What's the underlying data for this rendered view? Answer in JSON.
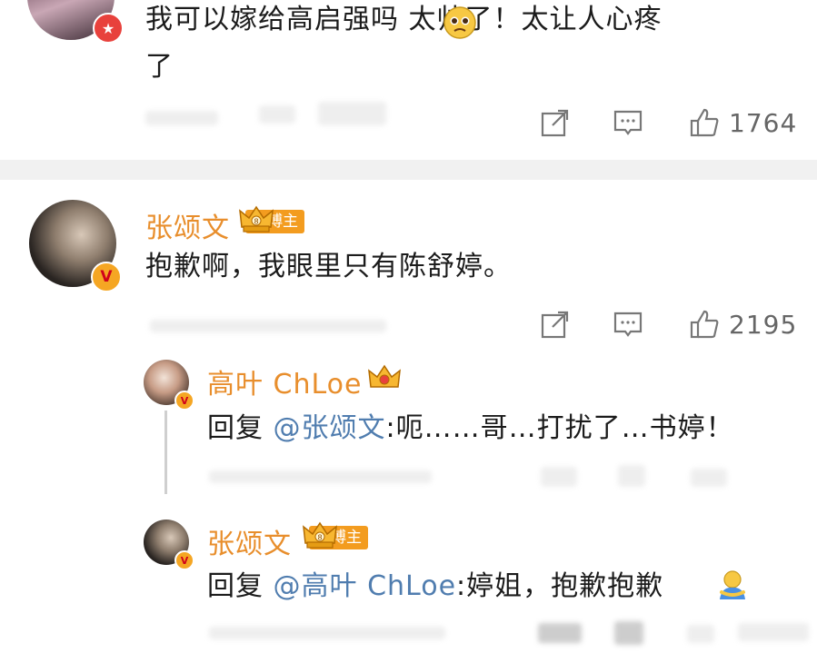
{
  "comments": [
    {
      "text": "我可以嫁给高启强吗 太帅了！太让人心疼",
      "text_line2": "了",
      "emoji": "pleading-face-icon",
      "like_count": "1764",
      "badge_color": "#e8413c"
    },
    {
      "author": "张颂文",
      "tag": "博主",
      "text": "抱歉啊，我眼里只有陈舒婷。",
      "like_count": "2195",
      "replies": [
        {
          "author": "高叶 ChLoe",
          "reply_prefix": "回复",
          "mention": "@张颂文",
          "text": ":呃……哥…打扰了…书婷！"
        },
        {
          "author": "张颂文",
          "tag": "博主",
          "reply_prefix": "回复",
          "mention": "@高叶 ChLoe",
          "text": ":婷姐，抱歉抱歉",
          "emoji": "hugging-person-icon"
        }
      ]
    }
  ],
  "colors": {
    "name": "#e88e2c",
    "mention": "#507daf",
    "tag_bg": "#f39c1f",
    "divider": "#f1f1f1"
  }
}
